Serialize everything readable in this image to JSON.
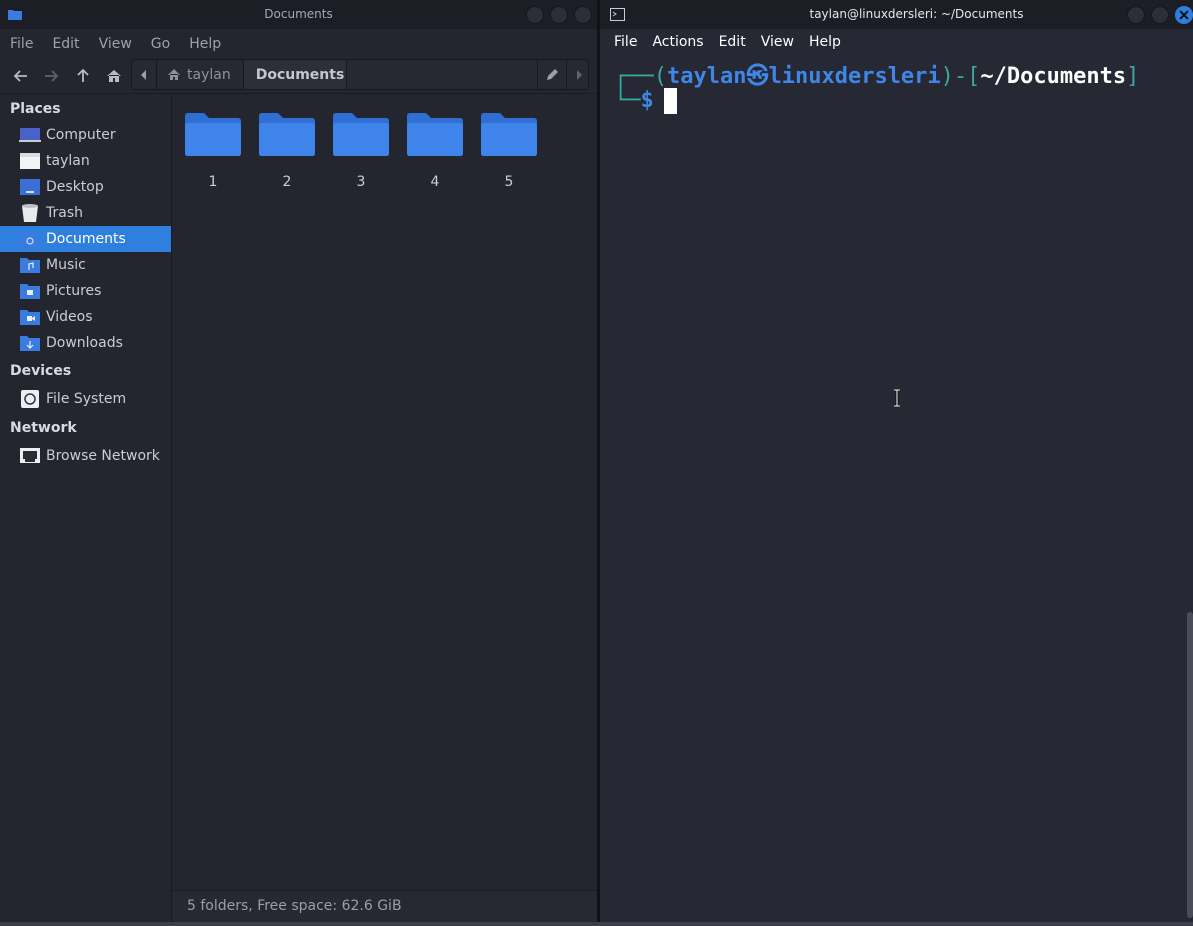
{
  "file_manager": {
    "title": "Documents",
    "menu": [
      "File",
      "Edit",
      "View",
      "Go",
      "Help"
    ],
    "breadcrumb": {
      "home": "taylan",
      "current": "Documents"
    },
    "sidebar": {
      "places_header": "Places",
      "places": [
        {
          "label": "Computer",
          "icon": "computer-icon"
        },
        {
          "label": "taylan",
          "icon": "home-folder-icon"
        },
        {
          "label": "Desktop",
          "icon": "desktop-icon"
        },
        {
          "label": "Trash",
          "icon": "trash-icon"
        },
        {
          "label": "Documents",
          "icon": "documents-folder-icon",
          "selected": true
        },
        {
          "label": "Music",
          "icon": "music-folder-icon"
        },
        {
          "label": "Pictures",
          "icon": "pictures-folder-icon"
        },
        {
          "label": "Videos",
          "icon": "videos-folder-icon"
        },
        {
          "label": "Downloads",
          "icon": "downloads-folder-icon"
        }
      ],
      "devices_header": "Devices",
      "devices": [
        {
          "label": "File System",
          "icon": "drive-icon"
        }
      ],
      "network_header": "Network",
      "network": [
        {
          "label": "Browse Network",
          "icon": "network-icon"
        }
      ]
    },
    "folders": [
      "1",
      "2",
      "3",
      "4",
      "5"
    ],
    "status": "5 folders, Free space: 62.6 GiB"
  },
  "terminal": {
    "title": "taylan@linuxdersleri: ~/Documents",
    "menu": [
      "File",
      "Actions",
      "Edit",
      "View",
      "Help"
    ],
    "prompt": {
      "user": "taylan",
      "host": "linuxdersleri",
      "path": "~/Documents",
      "symbol": "$"
    }
  },
  "colors": {
    "accent": "#2f7fdf",
    "folder": "#3a7be0",
    "prompt_blue": "#3f86e6",
    "prompt_teal": "#3aa8a0"
  }
}
